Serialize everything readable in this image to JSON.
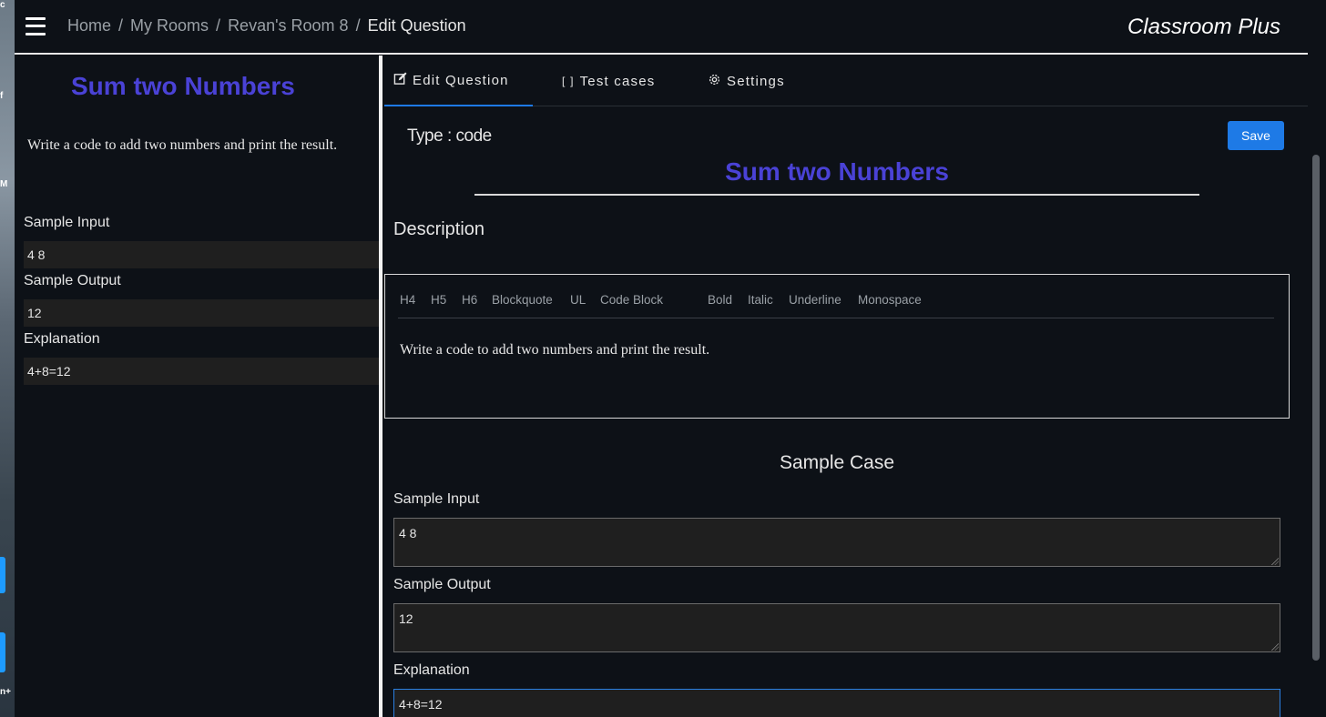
{
  "header": {
    "breadcrumb": [
      {
        "label": "Home"
      },
      {
        "label": "My Rooms"
      },
      {
        "label": "Revan's Room 8"
      },
      {
        "label": "Edit Question"
      }
    ],
    "separator": "/",
    "brand": "Classroom Plus"
  },
  "left_panel": {
    "title": "Sum two Numbers",
    "description": "Write a code to add two numbers and print the result.",
    "sample_input_label": "Sample Input",
    "sample_input_value": "4 8",
    "sample_output_label": "Sample Output",
    "sample_output_value": "12",
    "explanation_label": "Explanation",
    "explanation_value": "4+8=12"
  },
  "tabs": [
    {
      "label": "Edit Question",
      "icon": "edit-icon",
      "active": true
    },
    {
      "label": "Test cases",
      "icon": "brackets-icon",
      "active": false
    },
    {
      "label": "Settings",
      "icon": "gear-icon",
      "active": false
    }
  ],
  "editor": {
    "type_label": "Type : code",
    "save_label": "Save",
    "title": "Sum two Numbers",
    "description_heading": "Description",
    "toolbar": [
      "H4",
      "H5",
      "H6",
      "Blockquote",
      "UL",
      "Code Block",
      "Bold",
      "Italic",
      "Underline",
      "Monospace"
    ],
    "content": "Write a code to add two numbers and print the result.",
    "sample_case_heading": "Sample Case",
    "sample_input_label": "Sample Input",
    "sample_input_value": "4 8",
    "sample_output_label": "Sample Output",
    "sample_output_value": "12",
    "explanation_label": "Explanation",
    "explanation_value": "4+8=12"
  },
  "colors": {
    "background": "#0d1117",
    "title_accent": "#4a42d6",
    "primary_button": "#1e7ae6",
    "field_bg": "#1f1f1f"
  }
}
